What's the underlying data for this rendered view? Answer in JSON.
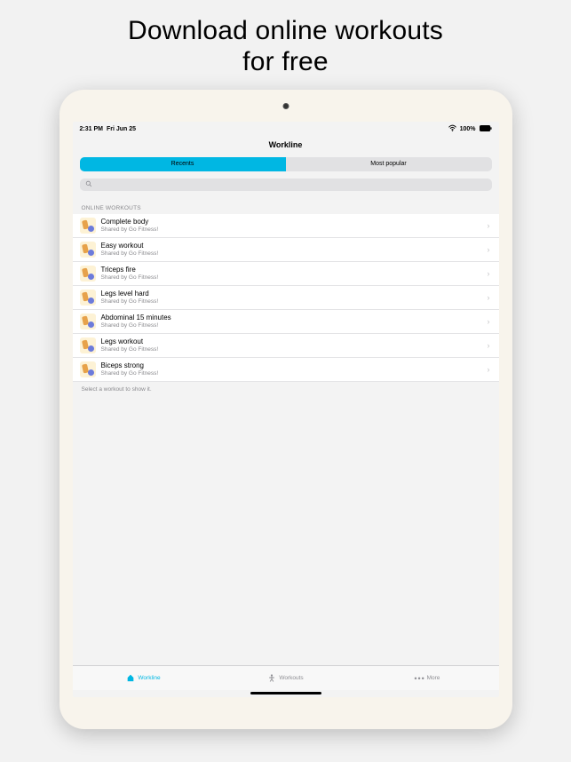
{
  "marketing": {
    "line1": "Download online workouts",
    "line2": "for free"
  },
  "statusbar": {
    "time": "2:31 PM",
    "date": "Fri Jun 25",
    "battery": "100%"
  },
  "nav": {
    "title": "Workline"
  },
  "segments": {
    "recents": "Recents",
    "popular": "Most popular"
  },
  "section": {
    "header": "ONLINE WORKOUTS"
  },
  "workouts": [
    {
      "title": "Complete body",
      "subtitle": "Shared by Go Fitness!"
    },
    {
      "title": "Easy workout",
      "subtitle": "Shared by Go Fitness!"
    },
    {
      "title": "Triceps fire",
      "subtitle": "Shared by Go Fitness!"
    },
    {
      "title": "Legs level hard",
      "subtitle": "Shared by Go Fitness!"
    },
    {
      "title": "Abdominal 15 minutes",
      "subtitle": "Shared by Go Fitness!"
    },
    {
      "title": "Legs workout",
      "subtitle": "Shared by Go Fitness!"
    },
    {
      "title": "Biceps strong",
      "subtitle": "Shared by Go Fitness!"
    }
  ],
  "hint": "Select a workout to show it.",
  "tabs": {
    "workline": "Workline",
    "workouts": "Workouts",
    "more": "More"
  }
}
